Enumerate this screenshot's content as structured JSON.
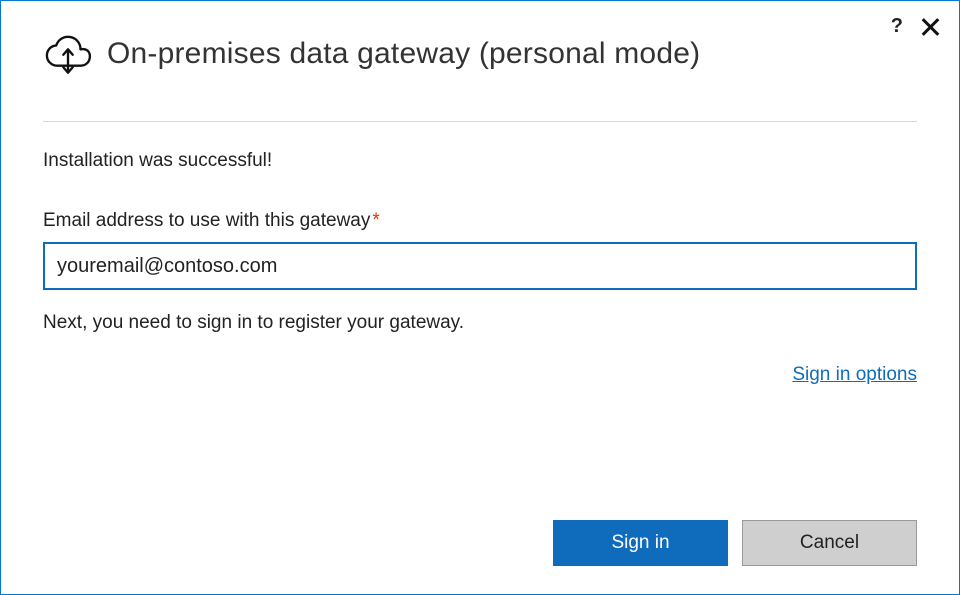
{
  "header": {
    "title": "On-premises data gateway (personal mode)"
  },
  "status": {
    "message": "Installation was successful!"
  },
  "email": {
    "label": "Email address to use with this gateway",
    "required_mark": "*",
    "value": "youremail@contoso.com"
  },
  "hint": {
    "text": "Next, you need to sign in to register your gateway."
  },
  "links": {
    "signin_options": "Sign in options"
  },
  "buttons": {
    "signin": "Sign in",
    "cancel": "Cancel"
  },
  "titlebar": {
    "help_glyph": "?"
  }
}
